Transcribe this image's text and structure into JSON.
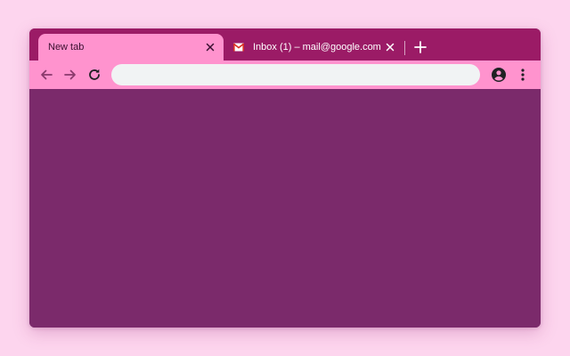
{
  "tabs": [
    {
      "title": "New tab",
      "active": true,
      "close_icon": "close-icon"
    },
    {
      "title": "Inbox (1) – mail@google.com",
      "active": false,
      "favicon": "gmail-icon",
      "close_icon": "close-icon"
    }
  ],
  "toolbar": {
    "back_icon": "arrow-back-icon",
    "forward_icon": "arrow-forward-icon",
    "reload_icon": "reload-icon",
    "omnibox_value": "",
    "profile_icon": "account-circle-icon",
    "menu_icon": "more-vert-icon"
  },
  "colors": {
    "page_background": "#fdd5ee",
    "tabstrip": "#9b1b66",
    "active_tab_and_toolbar": "#ff93ce",
    "content": "#7b2a6b",
    "omnibox": "#f1f3f4"
  }
}
